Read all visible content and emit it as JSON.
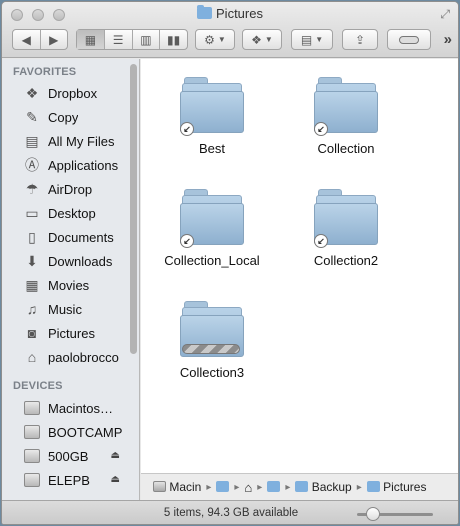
{
  "window": {
    "title": "Pictures"
  },
  "toolbar": {
    "back_icon": "chevron-left-icon",
    "forward_icon": "chevron-right-icon",
    "views": [
      "icon-view-icon",
      "list-view-icon",
      "column-view-icon",
      "coverflow-view-icon"
    ],
    "more": "»"
  },
  "sidebar": {
    "favorites_header": "FAVORITES",
    "favorites": [
      {
        "label": "Dropbox",
        "icon": "dropbox-icon",
        "glyph": "❖"
      },
      {
        "label": "Copy",
        "icon": "copy-icon",
        "glyph": "✎"
      },
      {
        "label": "All My Files",
        "icon": "all-files-icon",
        "glyph": "▤"
      },
      {
        "label": "Applications",
        "icon": "applications-icon",
        "glyph": "Ⓐ"
      },
      {
        "label": "AirDrop",
        "icon": "airdrop-icon",
        "glyph": "☂"
      },
      {
        "label": "Desktop",
        "icon": "desktop-icon",
        "glyph": "▭"
      },
      {
        "label": "Documents",
        "icon": "documents-icon",
        "glyph": "▯"
      },
      {
        "label": "Downloads",
        "icon": "downloads-icon",
        "glyph": "⬇"
      },
      {
        "label": "Movies",
        "icon": "movies-icon",
        "glyph": "▦"
      },
      {
        "label": "Music",
        "icon": "music-icon",
        "glyph": "♫"
      },
      {
        "label": "Pictures",
        "icon": "pictures-icon",
        "glyph": "◙"
      },
      {
        "label": "paolobrocco",
        "icon": "home-icon",
        "glyph": "⌂"
      }
    ],
    "devices_header": "DEVICES",
    "devices": [
      {
        "label": "Macintos…",
        "icon": "hard-disk-icon",
        "eject": false
      },
      {
        "label": "BOOTCAMP",
        "icon": "hard-disk-icon",
        "eject": false
      },
      {
        "label": "500GB",
        "icon": "hard-disk-icon",
        "eject": true
      },
      {
        "label": "ELEPB",
        "icon": "hard-disk-icon",
        "eject": true
      }
    ]
  },
  "items": [
    {
      "name": "Best",
      "alias": true,
      "in_progress": false
    },
    {
      "name": "Collection",
      "alias": true,
      "in_progress": false
    },
    {
      "name": "Collection_Local",
      "alias": true,
      "in_progress": false
    },
    {
      "name": "Collection2",
      "alias": true,
      "in_progress": false
    },
    {
      "name": "Collection3",
      "alias": false,
      "in_progress": true
    }
  ],
  "pathbar": {
    "segments": [
      {
        "label": "Macin",
        "icon": "hard-disk-icon"
      },
      {
        "label": "",
        "icon": "folder-icon"
      },
      {
        "label": "",
        "icon": "home-icon"
      },
      {
        "label": "",
        "icon": "folder-icon"
      },
      {
        "label": "Backup",
        "icon": "folder-icon"
      },
      {
        "label": "Pictures",
        "icon": "folder-icon"
      }
    ]
  },
  "status": {
    "text": "5 items, 94.3 GB available",
    "zoom_level": 0.15
  }
}
